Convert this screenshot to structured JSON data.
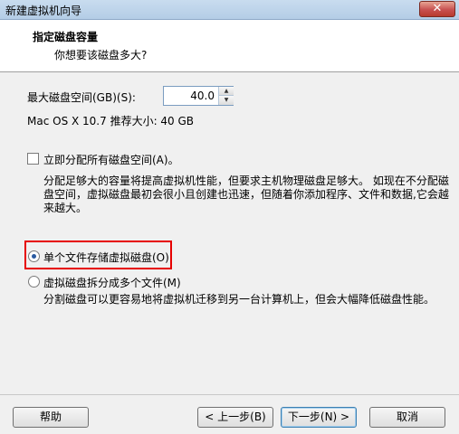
{
  "window": {
    "title": "新建虚拟机向导",
    "close_label": "✕"
  },
  "header": {
    "title": "指定磁盘容量",
    "subtitle": "你想要该磁盘多大?"
  },
  "disk": {
    "size_label": "最大磁盘空间(GB)(S):",
    "size_value": "40.0",
    "recommend": "Mac OS X 10.7 推荐大小: 40 GB"
  },
  "allocate": {
    "label": "立即分配所有磁盘空间(A)。",
    "checked": false,
    "desc": "分配足够大的容量将提高虚拟机性能，但要求主机物理磁盘足够大。 如现在不分配磁盘空间，虚拟磁盘最初会很小且创建也迅速，但随着你添加程序、文件和数据,它会越来越大。"
  },
  "storage": {
    "single_label": "单个文件存储虚拟磁盘(O)",
    "single_selected": true,
    "split_label": "虚拟磁盘拆分成多个文件(M)",
    "split_desc": "分割磁盘可以更容易地将虚拟机迁移到另一台计算机上，但会大幅降低磁盘性能。"
  },
  "footer": {
    "help": "帮助",
    "back": "< 上一步(B)",
    "next": "下一步(N) >",
    "cancel": "取消"
  },
  "colors": {
    "highlight": "#e60000",
    "accent": "#3c7fb1"
  }
}
